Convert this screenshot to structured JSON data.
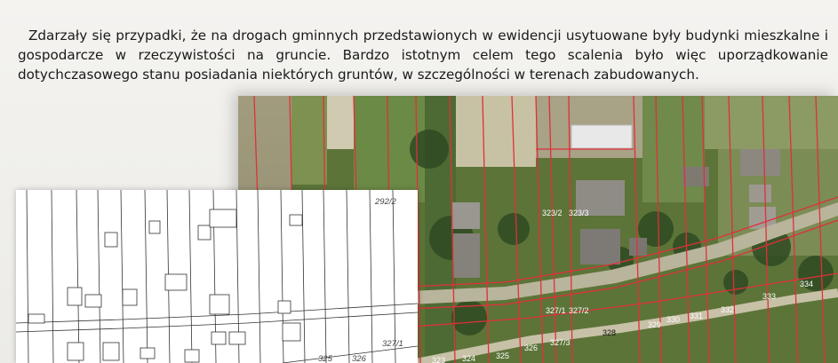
{
  "caption": "Zdarzały się przypadki, że na drogach gminnych przedstawionych w ewidencji usytuowane były budynki mieszkalne i gospodarcze w rzeczywistości na gruncie. Bardzo istotnym celem tego scalenia było więc uporządkowanie dotychczasowego stanu posiadania niektórych gruntów, w szczególności w terenach zabudowanych.",
  "aerial_parcels": [
    "323/2",
    "323/3",
    "327/1",
    "327/2",
    "327/3",
    "324",
    "325",
    "326",
    "328",
    "329",
    "330",
    "331",
    "332",
    "333",
    "334",
    "323"
  ],
  "map_parcels": [
    "292/2",
    "327/1",
    "325",
    "326"
  ],
  "colors": {
    "parcel_lines": "#e0303a",
    "field_green": "#5f7a3a",
    "road": "#b9b49c"
  }
}
